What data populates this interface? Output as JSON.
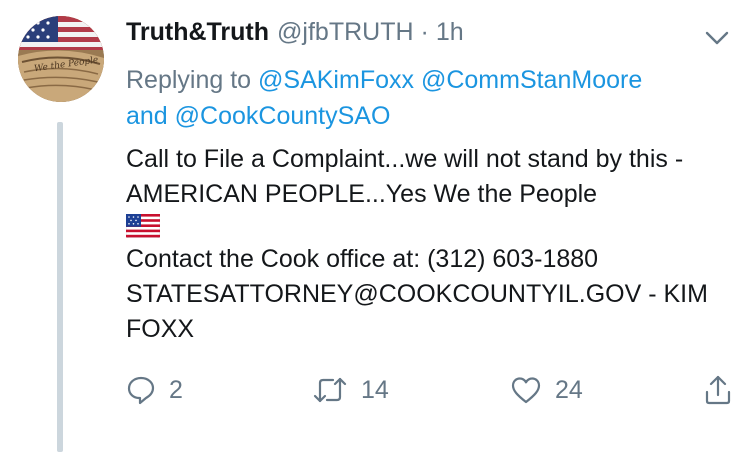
{
  "tweet": {
    "author_name": "Truth&Truth",
    "author_handle": "@jfbTRUTH",
    "separator": "·",
    "time": "1h",
    "reply_prefix": "Replying to",
    "reply_mentions": [
      "@SAKimFoxx",
      "@CommStanMoore"
    ],
    "reply_and": "and",
    "reply_last_mention": "@CookCountySAO",
    "text_line1": "Call to File a Complaint...we will not stand by this - AMERICAN PEOPLE...Yes We the People",
    "text_line2": "Contact the Cook office at: (312) 603-1880 STATESATTORNEY@COOKCOUNTYIL.GOV - KIM FOXX",
    "avatar_caption": "We the People"
  },
  "actions": {
    "reply_count": "2",
    "retweet_count": "14",
    "like_count": "24"
  },
  "icons": {
    "menu": "chevron-down-icon",
    "reply": "reply-icon",
    "retweet": "retweet-icon",
    "like": "heart-icon",
    "share": "share-icon",
    "emoji": "us-flag-emoji"
  },
  "colors": {
    "link": "#1b95e0",
    "muted": "#657786",
    "text": "#14171a",
    "thread_line": "#ccd6dd"
  }
}
